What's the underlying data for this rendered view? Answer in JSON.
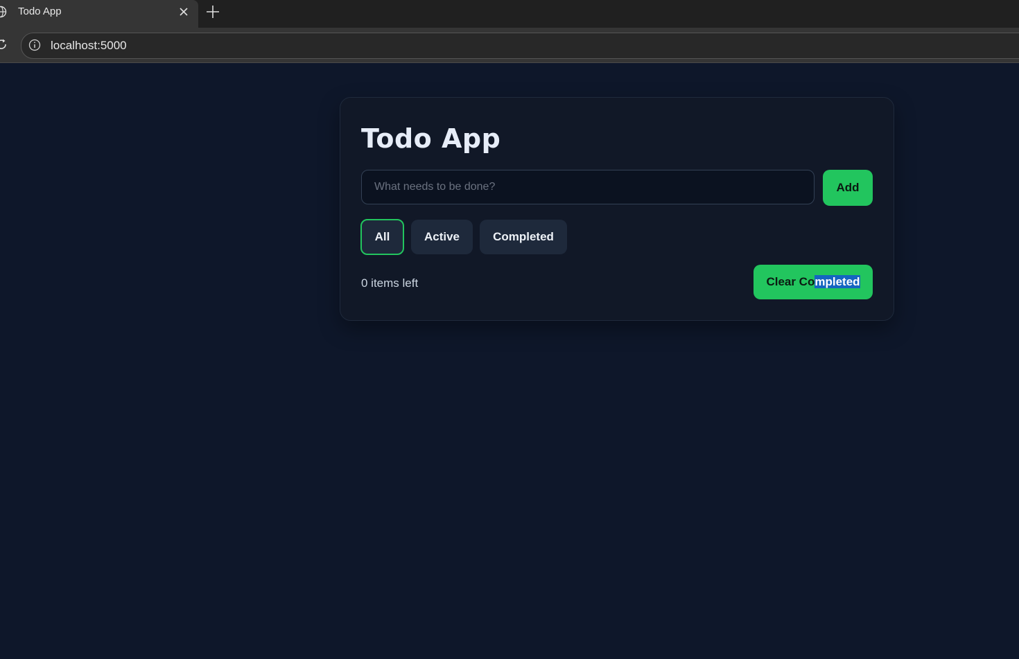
{
  "browser": {
    "tab_title": "Todo App",
    "url": "localhost:5000",
    "icons": [
      "globe-icon",
      "close-icon",
      "plus-icon",
      "reload-icon",
      "info-icon"
    ]
  },
  "app": {
    "title": "Todo App",
    "input_placeholder": "What needs to be done?",
    "input_value": "",
    "add_label": "Add",
    "filters": [
      {
        "label": "All",
        "selected": true
      },
      {
        "label": "Active",
        "selected": false
      },
      {
        "label": "Completed",
        "selected": false
      }
    ],
    "items_left": "0 items left",
    "clear_label_part1": "Clear Co",
    "clear_label_part2": "mpleted"
  },
  "colors": {
    "page_bg": "#0e172a",
    "card_bg": "#111827",
    "accent": "#22c55e",
    "filter_bg": "#1e293b",
    "selection": "#1565c0"
  }
}
